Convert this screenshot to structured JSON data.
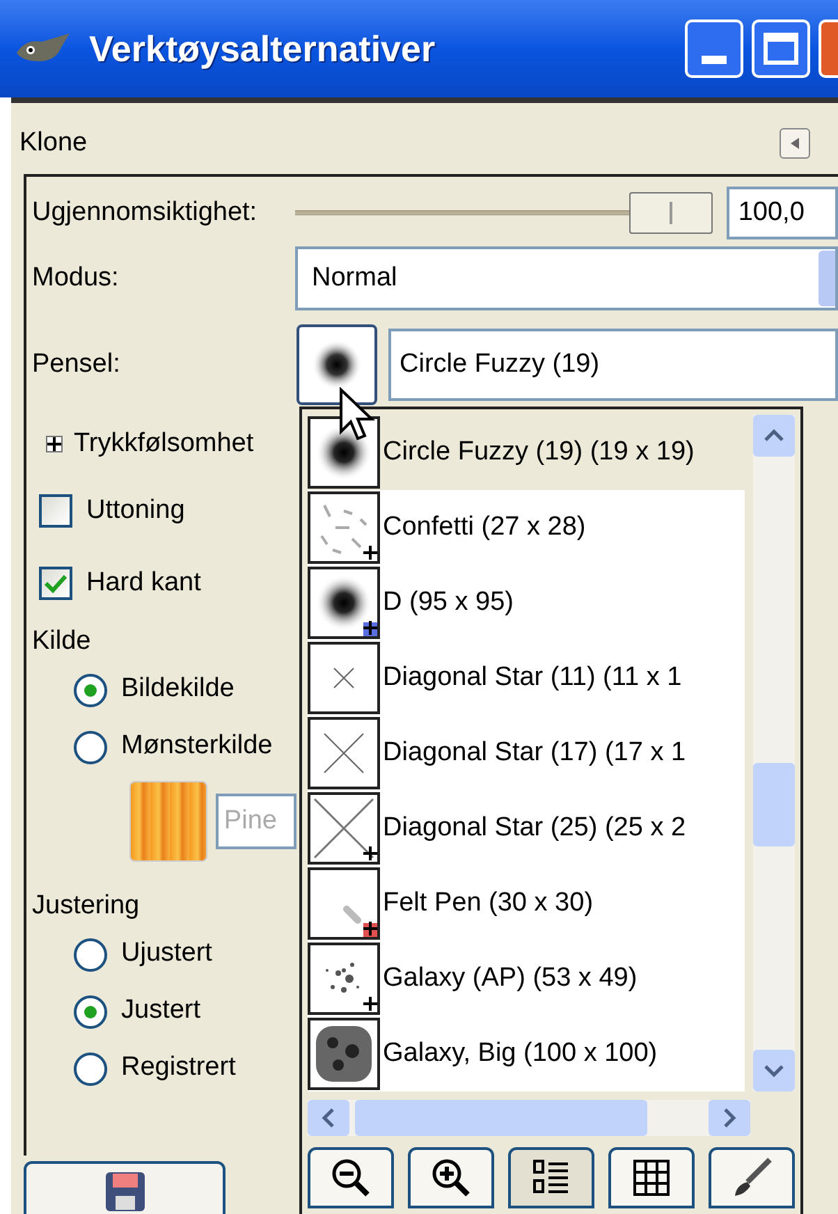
{
  "window": {
    "title": "Verktøysalternativer"
  },
  "tool": {
    "name": "Klone"
  },
  "opacity": {
    "label": "Ugjennomsiktighet:",
    "level": 1,
    "value": "100,0"
  },
  "mode": {
    "label": "Modus:",
    "value": "Normal"
  },
  "brush": {
    "label": "Pensel:",
    "value": "Circle Fuzzy (19)"
  },
  "pressure": {
    "label": "Trykkfølsomhet",
    "expanded": false
  },
  "checkboxes": [
    {
      "label": "Uttoning",
      "checked": false
    },
    {
      "label": "Hard kant",
      "checked": true
    }
  ],
  "source": {
    "heading": "Kilde",
    "options": [
      {
        "label": "Bildekilde",
        "selected": true
      },
      {
        "label": "Mønsterkilde",
        "selected": false
      }
    ],
    "pattern": "Pine"
  },
  "alignment": {
    "heading": "Justering",
    "options": [
      {
        "label": "Ujustert",
        "selected": false
      },
      {
        "label": "Justert",
        "selected": true
      },
      {
        "label": "Registrert",
        "selected": false
      }
    ]
  },
  "brush_popup": {
    "items": [
      {
        "name": "Circle Fuzzy (19) (19 x 19)",
        "kind": "fuzzy",
        "selected": true,
        "badge": false
      },
      {
        "name": "Confetti (27 x 28)",
        "kind": "confetti",
        "selected": false,
        "badge": true
      },
      {
        "name": "D (95 x 95)",
        "kind": "fuzzy",
        "selected": false,
        "badge": true,
        "color": "#5a6ee0"
      },
      {
        "name": "Diagonal Star (11) (11 x 1",
        "kind": "star-small",
        "selected": false,
        "badge": false
      },
      {
        "name": "Diagonal Star (17) (17 x 1",
        "kind": "star",
        "selected": false,
        "badge": false
      },
      {
        "name": "Diagonal Star (25) (25 x 2",
        "kind": "star-large",
        "selected": false,
        "badge": true
      },
      {
        "name": "Felt Pen (30 x 30)",
        "kind": "pen",
        "selected": false,
        "badge": true,
        "color": "#e05050"
      },
      {
        "name": "Galaxy (AP) (53 x 49)",
        "kind": "galaxy",
        "selected": false,
        "badge": true
      },
      {
        "name": "Galaxy, Big (100 x 100)",
        "kind": "galaxy-big",
        "selected": false,
        "badge": false
      }
    ],
    "tools": [
      {
        "kind": "zoom-out",
        "selected": false
      },
      {
        "kind": "zoom-in",
        "selected": false
      },
      {
        "kind": "list",
        "selected": true
      },
      {
        "kind": "grid",
        "selected": false
      },
      {
        "kind": "paintbrush",
        "selected": false
      }
    ]
  }
}
